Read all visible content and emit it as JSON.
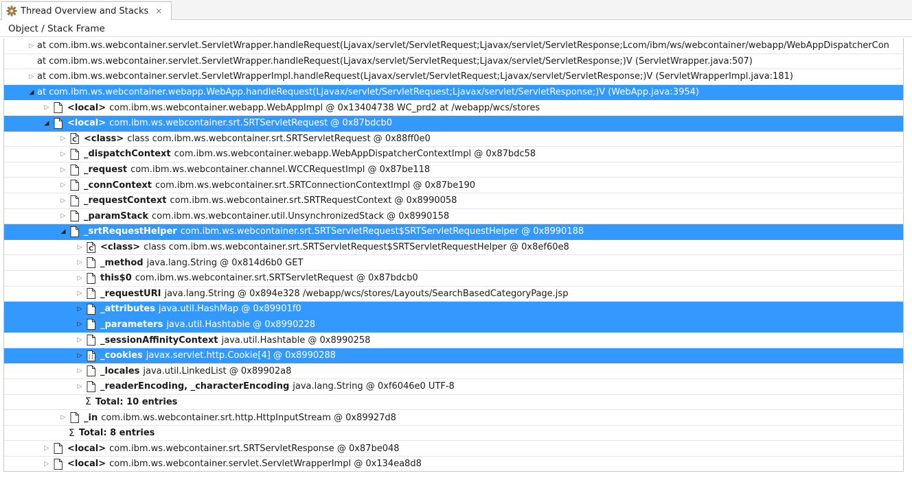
{
  "tab": {
    "title": "Thread Overview and Stacks",
    "icon": "gear-icon",
    "close_glyph": "×"
  },
  "column_header": "Object / Stack Frame",
  "colors": {
    "selection": "#3399ff",
    "selection_text": "#ffffff"
  },
  "rows": [
    {
      "name": "tree-row-frame",
      "level": 0,
      "expander": "collapsed",
      "icon": "none",
      "selected": false,
      "bold": "",
      "text": "at com.ibm.ws.webcontainer.servlet.ServletWrapper.handleRequest(Ljavax/servlet/ServletRequest;Ljavax/servlet/ServletResponse;Lcom/ibm/ws/webcontainer/webapp/WebAppDispatcherCon"
    },
    {
      "name": "tree-row-frame",
      "level": 0,
      "expander": "none",
      "icon": "none",
      "selected": false,
      "bold": "",
      "text": "at com.ibm.ws.webcontainer.servlet.ServletWrapper.handleRequest(Ljavax/servlet/ServletRequest;Ljavax/servlet/ServletResponse;)V (ServletWrapper.java:507)"
    },
    {
      "name": "tree-row-frame",
      "level": 0,
      "expander": "collapsed",
      "icon": "none",
      "selected": false,
      "bold": "",
      "text": "at com.ibm.ws.webcontainer.servlet.ServletWrapperImpl.handleRequest(Ljavax/servlet/ServletRequest;Ljavax/servlet/ServletResponse;)V (ServletWrapperImpl.java:181)"
    },
    {
      "name": "tree-row-frame",
      "level": 0,
      "expander": "expanded",
      "icon": "none",
      "selected": true,
      "bold": "",
      "text": "at com.ibm.ws.webcontainer.webapp.WebApp.handleRequest(Ljavax/servlet/ServletRequest;Ljavax/servlet/ServletResponse;)V (WebApp.java:3954)"
    },
    {
      "name": "tree-row-local",
      "level": 1,
      "expander": "collapsed",
      "icon": "file",
      "selected": false,
      "bold": "<local>",
      "text": "com.ibm.ws.webcontainer.webapp.WebAppImpl @ 0x13404738  WC_prd2 at /webapp/wcs/stores"
    },
    {
      "name": "tree-row-local",
      "level": 1,
      "expander": "expanded",
      "icon": "file",
      "selected": true,
      "bold": "<local>",
      "text": "com.ibm.ws.webcontainer.srt.SRTServletRequest @ 0x87bdcb0"
    },
    {
      "name": "tree-row-field",
      "level": 2,
      "expander": "collapsed",
      "icon": "class",
      "selected": false,
      "bold": "<class>",
      "text": "class com.ibm.ws.webcontainer.srt.SRTServletRequest @ 0x88ff0e0"
    },
    {
      "name": "tree-row-field",
      "level": 2,
      "expander": "collapsed",
      "icon": "file",
      "selected": false,
      "bold": "_dispatchContext",
      "text": "com.ibm.ws.webcontainer.webapp.WebAppDispatcherContextImpl @ 0x87bdc58"
    },
    {
      "name": "tree-row-field",
      "level": 2,
      "expander": "collapsed",
      "icon": "file",
      "selected": false,
      "bold": "_request",
      "text": "com.ibm.ws.webcontainer.channel.WCCRequestImpl @ 0x87be118"
    },
    {
      "name": "tree-row-field",
      "level": 2,
      "expander": "collapsed",
      "icon": "file",
      "selected": false,
      "bold": "_connContext",
      "text": "com.ibm.ws.webcontainer.srt.SRTConnectionContextImpl @ 0x87be190"
    },
    {
      "name": "tree-row-field",
      "level": 2,
      "expander": "collapsed",
      "icon": "file",
      "selected": false,
      "bold": "_requestContext",
      "text": "com.ibm.ws.webcontainer.srt.SRTRequestContext @ 0x8990058"
    },
    {
      "name": "tree-row-field",
      "level": 2,
      "expander": "collapsed",
      "icon": "file",
      "selected": false,
      "bold": "_paramStack",
      "text": "com.ibm.ws.webcontainer.util.UnsynchronizedStack @ 0x8990158"
    },
    {
      "name": "tree-row-field",
      "level": 2,
      "expander": "expanded",
      "icon": "file",
      "selected": true,
      "bold": "_srtRequestHelper",
      "text": "com.ibm.ws.webcontainer.srt.SRTServletRequest$SRTServletRequestHelper @ 0x8990188"
    },
    {
      "name": "tree-row-field",
      "level": 3,
      "expander": "collapsed",
      "icon": "class",
      "selected": false,
      "bold": "<class>",
      "text": "class com.ibm.ws.webcontainer.srt.SRTServletRequest$SRTServletRequestHelper @ 0x8ef60e8"
    },
    {
      "name": "tree-row-field",
      "level": 3,
      "expander": "collapsed",
      "icon": "file",
      "selected": false,
      "bold": "_method",
      "text": "java.lang.String @ 0x814d6b0  GET"
    },
    {
      "name": "tree-row-field",
      "level": 3,
      "expander": "collapsed",
      "icon": "file",
      "selected": false,
      "bold": "this$0",
      "text": "com.ibm.ws.webcontainer.srt.SRTServletRequest @ 0x87bdcb0"
    },
    {
      "name": "tree-row-field",
      "level": 3,
      "expander": "collapsed",
      "icon": "file",
      "selected": false,
      "bold": "_requestURI",
      "text": "java.lang.String @ 0x894e328  /webapp/wcs/stores/Layouts/SearchBasedCategoryPage.jsp"
    },
    {
      "name": "tree-row-field",
      "level": 3,
      "expander": "collapsed",
      "icon": "file",
      "selected": true,
      "bold": "_attributes",
      "text": "java.util.HashMap @ 0x89901f0"
    },
    {
      "name": "tree-row-field",
      "level": 3,
      "expander": "collapsed",
      "icon": "file",
      "selected": true,
      "bold": "_parameters",
      "text": "java.util.Hashtable @ 0x8990228"
    },
    {
      "name": "tree-row-field",
      "level": 3,
      "expander": "collapsed",
      "icon": "file",
      "selected": false,
      "bold": "_sessionAffinityContext",
      "text": "java.util.Hashtable @ 0x8990258"
    },
    {
      "name": "tree-row-field",
      "level": 3,
      "expander": "collapsed",
      "icon": "array",
      "selected": true,
      "bold": "_cookies",
      "text": "javax.servlet.http.Cookie[4] @ 0x8990288"
    },
    {
      "name": "tree-row-field",
      "level": 3,
      "expander": "collapsed",
      "icon": "file",
      "selected": false,
      "bold": "_locales",
      "text": "java.util.LinkedList @ 0x89902a8"
    },
    {
      "name": "tree-row-field",
      "level": 3,
      "expander": "collapsed",
      "icon": "file",
      "selected": false,
      "bold": "_readerEncoding, _characterEncoding",
      "text": "java.lang.String @ 0xf6046e0  UTF-8"
    },
    {
      "name": "tree-row-total",
      "level": 3,
      "expander": "none",
      "icon": "sigma",
      "selected": false,
      "bold": "Total: 10 entries",
      "text": ""
    },
    {
      "name": "tree-row-field",
      "level": 2,
      "expander": "collapsed",
      "icon": "file",
      "selected": false,
      "bold": "_in",
      "text": "com.ibm.ws.webcontainer.srt.http.HttpInputStream @ 0x89927d8"
    },
    {
      "name": "tree-row-total",
      "level": 2,
      "expander": "none",
      "icon": "sigma",
      "selected": false,
      "bold": "Total: 8 entries",
      "text": ""
    },
    {
      "name": "tree-row-local",
      "level": 1,
      "expander": "collapsed",
      "icon": "file",
      "selected": false,
      "bold": "<local>",
      "text": "com.ibm.ws.webcontainer.srt.SRTServletResponse @ 0x87be048"
    },
    {
      "name": "tree-row-local",
      "level": 1,
      "expander": "collapsed",
      "icon": "file",
      "selected": false,
      "bold": "<local>",
      "text": "com.ibm.ws.webcontainer.servlet.ServletWrapperImpl @ 0x134ea8d8"
    }
  ]
}
